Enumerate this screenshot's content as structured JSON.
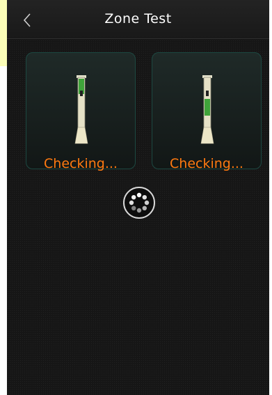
{
  "header": {
    "title": "Zone Test",
    "back_icon": "chevron-left-icon"
  },
  "zones": [
    {
      "status": "Checking...",
      "icon": "pipette-tube-icon"
    },
    {
      "status": "Checking...",
      "icon": "pipette-tube-icon"
    }
  ],
  "spinner": {
    "icon": "loading-spinner-icon"
  },
  "colors": {
    "status_text": "#ff7a10",
    "card_border": "#1d4942",
    "accent_green": "#3fa33a",
    "background": "#161616"
  }
}
